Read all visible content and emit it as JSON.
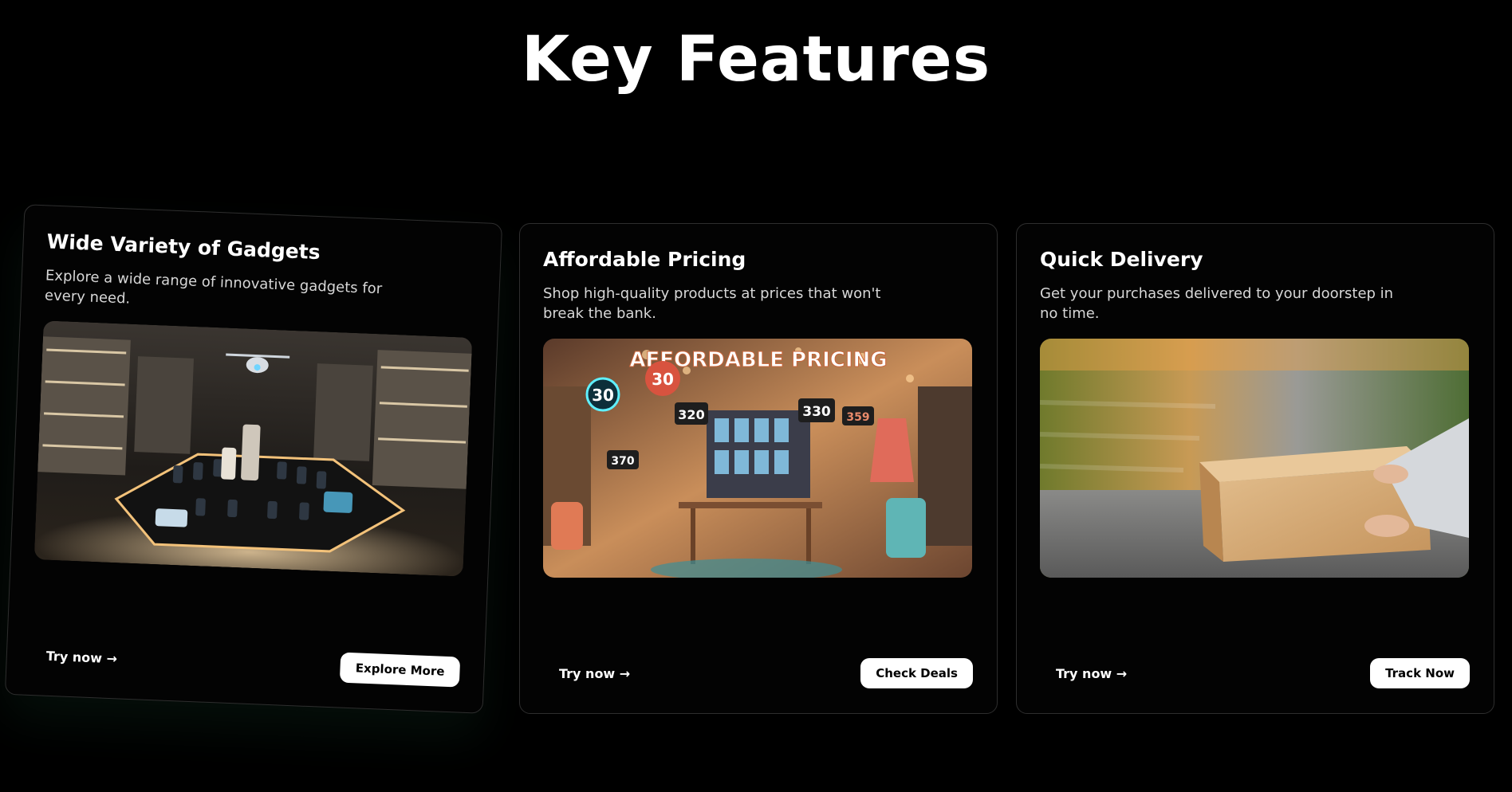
{
  "heading": "Key Features",
  "cards": [
    {
      "title": "Wide Variety of Gadgets",
      "description": "Explore a wide range of innovative gadgets for every need.",
      "try_label": "Try now →",
      "button_label": "Explore More",
      "image": "gadget-store-image"
    },
    {
      "title": "Affordable Pricing",
      "description": "Shop high-quality products at prices that won't break the bank.",
      "try_label": "Try now →",
      "button_label": "Check Deals",
      "image": "affordable-pricing-store-image",
      "image_text": {
        "banner": "AFFORDABLE PRICING",
        "badge1": "30",
        "badge2": "30",
        "tag1": "320",
        "tag2": "330",
        "tag3": "359",
        "tag4": "370"
      }
    },
    {
      "title": "Quick Delivery",
      "description": "Get your purchases delivered to your doorstep in no time.",
      "try_label": "Try now →",
      "button_label": "Track Now",
      "image": "delivery-package-image"
    }
  ]
}
